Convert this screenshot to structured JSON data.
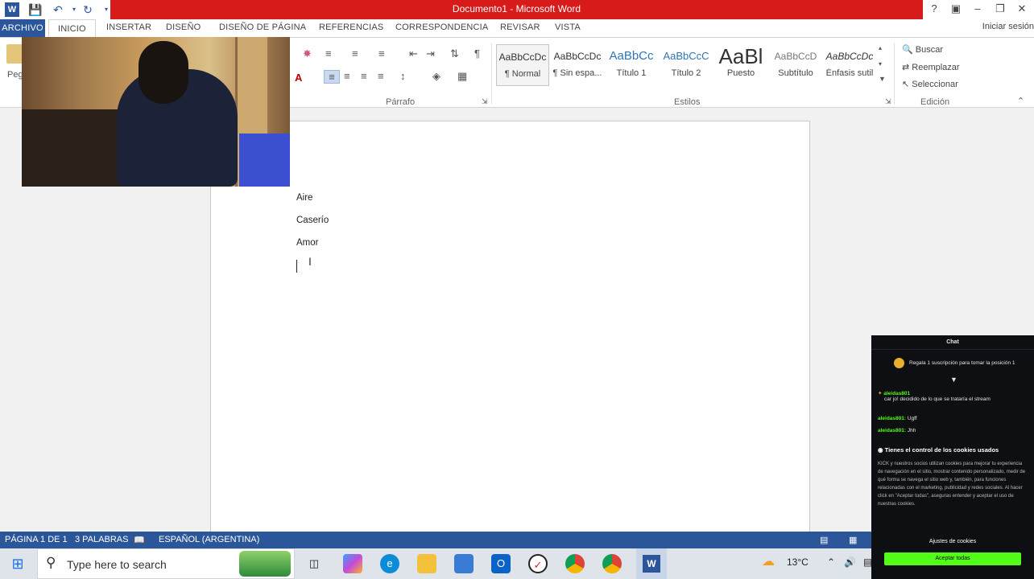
{
  "window": {
    "title": "Documento1 - Microsoft Word",
    "help": "?"
  },
  "tabs": {
    "file": "ARCHIVO",
    "home": "INICIO",
    "insert": "INSERTAR",
    "design": "DISEÑO",
    "layout": "DISEÑO DE PÁGINA",
    "references": "REFERENCIAS",
    "mailings": "CORRESPONDENCIA",
    "review": "REVISAR",
    "view": "VISTA",
    "signin": "Iniciar sesión"
  },
  "ribbon": {
    "paste_label": "Peg",
    "paragraph_label": "Párrafo",
    "styles_label": "Estilos",
    "editing_label": "Edición",
    "styles": [
      {
        "sample": "AaBbCcDc",
        "name": "¶ Normal"
      },
      {
        "sample": "AaBbCcDc",
        "name": "¶ Sin espa..."
      },
      {
        "sample": "AaBbCc",
        "name": "Título 1"
      },
      {
        "sample": "AaBbCcC",
        "name": "Título 2"
      },
      {
        "sample": "AaBl",
        "name": "Puesto"
      },
      {
        "sample": "AaBbCcD",
        "name": "Subtítulo"
      },
      {
        "sample": "AaBbCcDc",
        "name": "Énfasis sutil"
      }
    ],
    "find": "Buscar",
    "replace": "Reemplazar",
    "select": "Seleccionar"
  },
  "document": {
    "lines": [
      "Aire",
      "Caserío",
      "Amor"
    ]
  },
  "statusbar": {
    "page": "PÁGINA 1 DE 1",
    "words": "3 PALABRAS",
    "language": "ESPAÑOL (ARGENTINA)"
  },
  "taskbar": {
    "search_placeholder": "Type here to search",
    "temperature": "13°C"
  },
  "chat": {
    "header": "Chat",
    "pinned": "Regala 1 suscripción para tomar la posición 1",
    "messages": [
      {
        "user": "aleidas801",
        "text": "car jo! decidido de lo que se trataría el stream"
      },
      {
        "user": "aleidas801:",
        "text": "Ugff"
      },
      {
        "user": "aleidas801:",
        "text": "Jhh"
      }
    ],
    "cookie_title": "Tienes el control de los cookies usados",
    "cookie_body": "KICK y nuestros socios utilizan cookies para mejorar tu experiencia de navegación en el sitio, mostrar contenido personalizado, medir de qué forma se navega el sitio web y, también, para funciones relacionadas con el marketing, publicidad y redes sociales. Al hacer click en \"Aceptar todas\", aseguras entender y aceptar el uso de nuestras cookies.",
    "cookie_settings": "Ajustes de cookies",
    "accept_all": "Aceptar todas"
  },
  "colors": {
    "word_blue": "#2b579a",
    "title_red": "#d71a1a",
    "kick_green": "#53fc18"
  }
}
